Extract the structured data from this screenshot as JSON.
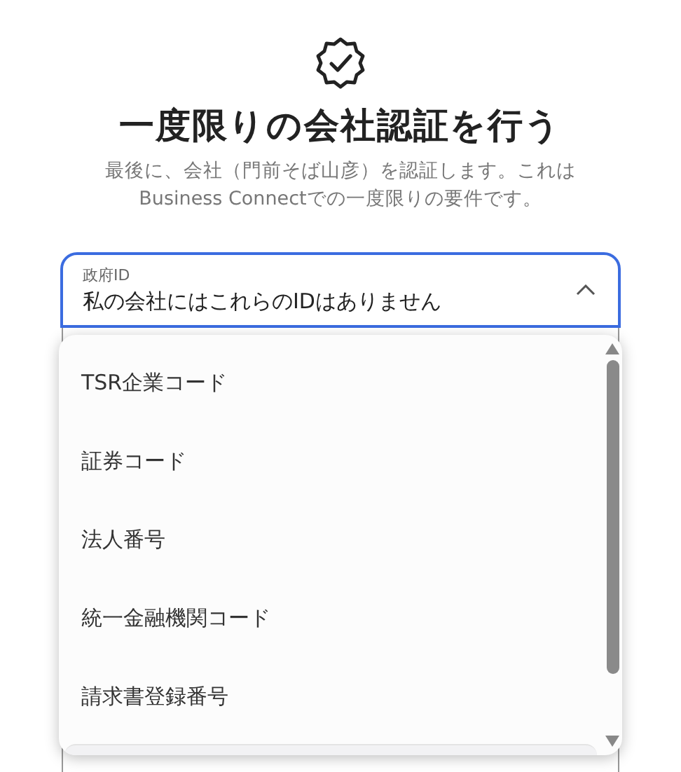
{
  "heading": {
    "title": "一度限りの会社認証を行う",
    "subtitle": "最後に、会社（門前そば山彦）を認証します。これはBusiness Connectでの一度限りの要件です。"
  },
  "field": {
    "label": "政府ID",
    "value": "私の会社にはこれらのIDはありません",
    "expanded": true
  },
  "options": [
    {
      "label": "TSR企業コード"
    },
    {
      "label": "証券コード"
    },
    {
      "label": "法人番号"
    },
    {
      "label": "統一金融機関コード"
    },
    {
      "label": "請求書登録番号"
    }
  ]
}
